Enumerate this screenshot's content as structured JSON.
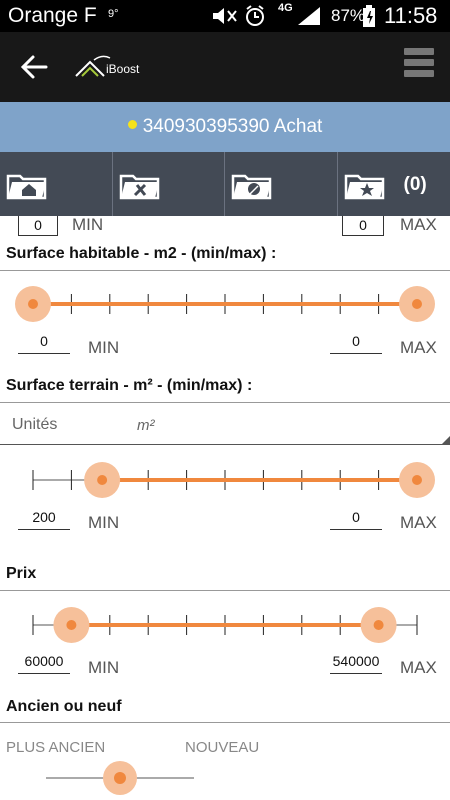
{
  "status_bar": {
    "carrier": "Orange F",
    "carrier_sup": "9°",
    "network": "4G",
    "battery": "87%",
    "time": "11:58"
  },
  "app_bar": {
    "logo_text": "iBoost",
    "icons": [
      "back-arrow-icon",
      "iboost-logo",
      "hamburger-menu-icon"
    ]
  },
  "banner": {
    "text": "340930395390 Achat",
    "dot_color": "#f5e21a",
    "background": "#7fa3c9"
  },
  "tabs": {
    "items": [
      {
        "icon": "folder-house-icon"
      },
      {
        "icon": "folder-tools-icon"
      },
      {
        "icon": "folder-pin-icon"
      },
      {
        "icon": "folder-star-icon",
        "count": "(0)"
      }
    ]
  },
  "top_partial": {
    "min_value": "0",
    "min_label": "MIN",
    "max_value": "0",
    "max_label": "MAX"
  },
  "surface_habitable": {
    "title": "Surface habitable - m2 - (min/max) :",
    "min_value": "0",
    "min_label": "MIN",
    "max_value": "0",
    "max_label": "MAX",
    "range_low_fraction": 0.0,
    "range_high_fraction": 1.0
  },
  "surface_terrain": {
    "title": "Surface terrain - m² - (min/max) :",
    "units_label": "Unités",
    "units_value": "m²",
    "min_value": "200",
    "min_label": "MIN",
    "max_value": "0",
    "max_label": "MAX",
    "range_low_fraction": 0.18,
    "range_high_fraction": 1.0
  },
  "prix": {
    "title": "Prix",
    "min_value": "60000",
    "min_label": "MIN",
    "max_value": "540000",
    "max_label": "MAX",
    "range_low_fraction": 0.1,
    "range_high_fraction": 0.9
  },
  "ancien_neuf": {
    "title": "Ancien ou neuf",
    "left_label": "PLUS ANCIEN",
    "right_label": "NOUVEAU",
    "position_fraction": 0.5
  },
  "colors": {
    "accent": "#f0883e",
    "accent_light": "#f6c09a",
    "appbar": "#181818",
    "tabs": "#434a55"
  }
}
